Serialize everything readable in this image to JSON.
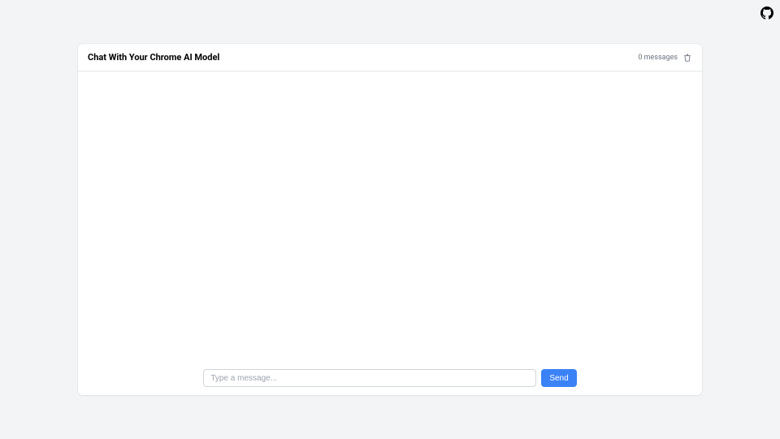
{
  "header": {
    "title": "Chat With Your Chrome AI Model",
    "message_count_label": "0 messages"
  },
  "composer": {
    "placeholder": "Type a message...",
    "value": "",
    "send_label": "Send"
  },
  "icons": {
    "github": "github-icon",
    "trash": "trash-icon"
  }
}
